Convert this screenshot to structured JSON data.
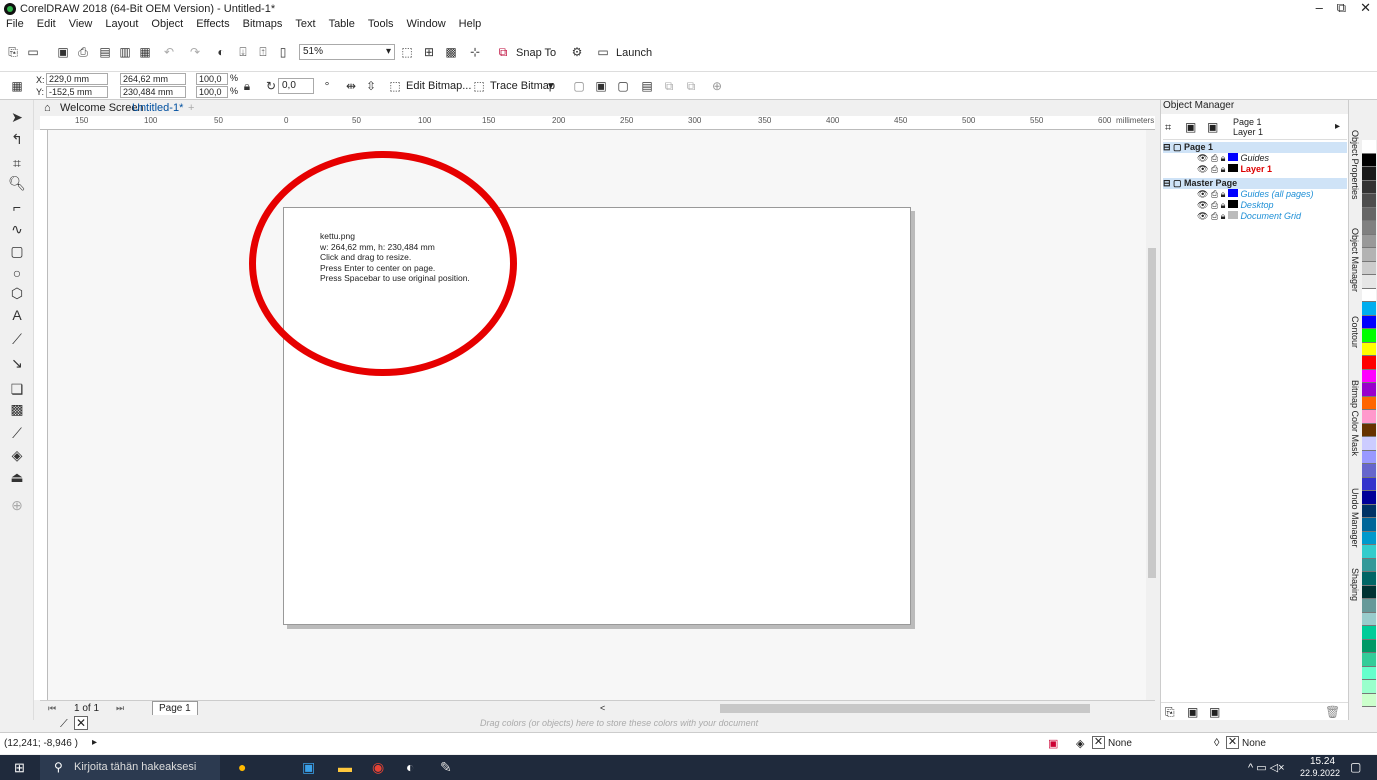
{
  "titlebar": {
    "title": "CorelDRAW 2018 (64-Bit OEM Version) - Untitled-1*",
    "minimize": "–",
    "restore": "⧉",
    "close": "✕"
  },
  "menu": [
    "File",
    "Edit",
    "View",
    "Layout",
    "Object",
    "Effects",
    "Bitmaps",
    "Text",
    "Table",
    "Tools",
    "Window",
    "Help"
  ],
  "toolbar1": {
    "zoom": "51%",
    "snap_to": "Snap To",
    "launch": "Launch"
  },
  "toolbar2": {
    "x_label": "X:",
    "x_value": "229,0 mm",
    "y_label": "Y:",
    "y_value": "-152,5 mm",
    "w_value": "264,62 mm",
    "h_value": "230,484 mm",
    "scale_w": "100,0",
    "scale_h": "100,0",
    "pct": "%",
    "rotation": "0,0",
    "edit_bitmap": "Edit Bitmap...",
    "trace_bitmap": "Trace Bitmap"
  },
  "tabs": {
    "welcome": "Welcome Screen",
    "doc": "Untitled-1*",
    "add": "+"
  },
  "ruler": {
    "ticks": [
      "150",
      "100",
      "50",
      "0",
      "50",
      "100",
      "150",
      "200",
      "250",
      "300",
      "350",
      "400",
      "450",
      "500",
      "550",
      "600"
    ],
    "unit": "millimeters"
  },
  "tooltip": {
    "line1": "kettu.png",
    "line2": "w: 264,62 mm, h: 230,484 mm",
    "line3": "Click and drag to resize.",
    "line4": "Press Enter to center on page.",
    "line5": "Press Spacebar to use original position."
  },
  "pager": {
    "count": "1 of 1",
    "page_tab": "Page 1"
  },
  "colorwell": {
    "hint": "Drag colors (or objects) here to store these colors with your document"
  },
  "status": {
    "coords": "(12,241; -8,946 )",
    "fill_none": "None",
    "outline_none": "None"
  },
  "object_manager": {
    "title": "Object Manager",
    "page_label": "Page 1",
    "layer_label": "Layer 1",
    "rows": [
      {
        "label": "Page 1",
        "style": "bold"
      },
      {
        "label": "Guides",
        "style": "italic-dark"
      },
      {
        "label": "Layer 1",
        "style": "bold-red"
      },
      {
        "label": "Master Page",
        "style": "bold"
      },
      {
        "label": "Guides (all pages)",
        "style": "italic-blue"
      },
      {
        "label": "Desktop",
        "style": "italic-blue"
      },
      {
        "label": "Document Grid",
        "style": "italic-blue"
      }
    ]
  },
  "side_tabs": [
    "Object Properties",
    "Object Manager",
    "Contour",
    "Bitmap Color Mask",
    "Undo Manager",
    "Shaping"
  ],
  "palette": [
    "#ffffff",
    "#000000",
    "#1a1a1a",
    "#333333",
    "#4d4d4d",
    "#666666",
    "#808080",
    "#999999",
    "#b3b3b3",
    "#cccccc",
    "#e6e6e6",
    "#ffffff",
    "#00aeef",
    "#0000ff",
    "#00ff00",
    "#ffff00",
    "#ff0000",
    "#ff00ff",
    "#9900cc",
    "#ff6600",
    "#ff99cc",
    "#663300",
    "#ccccff",
    "#9999ff",
    "#6666cc",
    "#3333cc",
    "#000099",
    "#003366",
    "#006699",
    "#0099cc",
    "#33cccc",
    "#339999",
    "#006666",
    "#003333",
    "#669999",
    "#99cccc",
    "#00cc99",
    "#009966",
    "#33cc99",
    "#66ffcc",
    "#99ffcc",
    "#ccffcc"
  ],
  "taskbar": {
    "search": "Kirjoita tähän hakeaksesi",
    "time": "15.24",
    "date": "22.9.2022"
  }
}
